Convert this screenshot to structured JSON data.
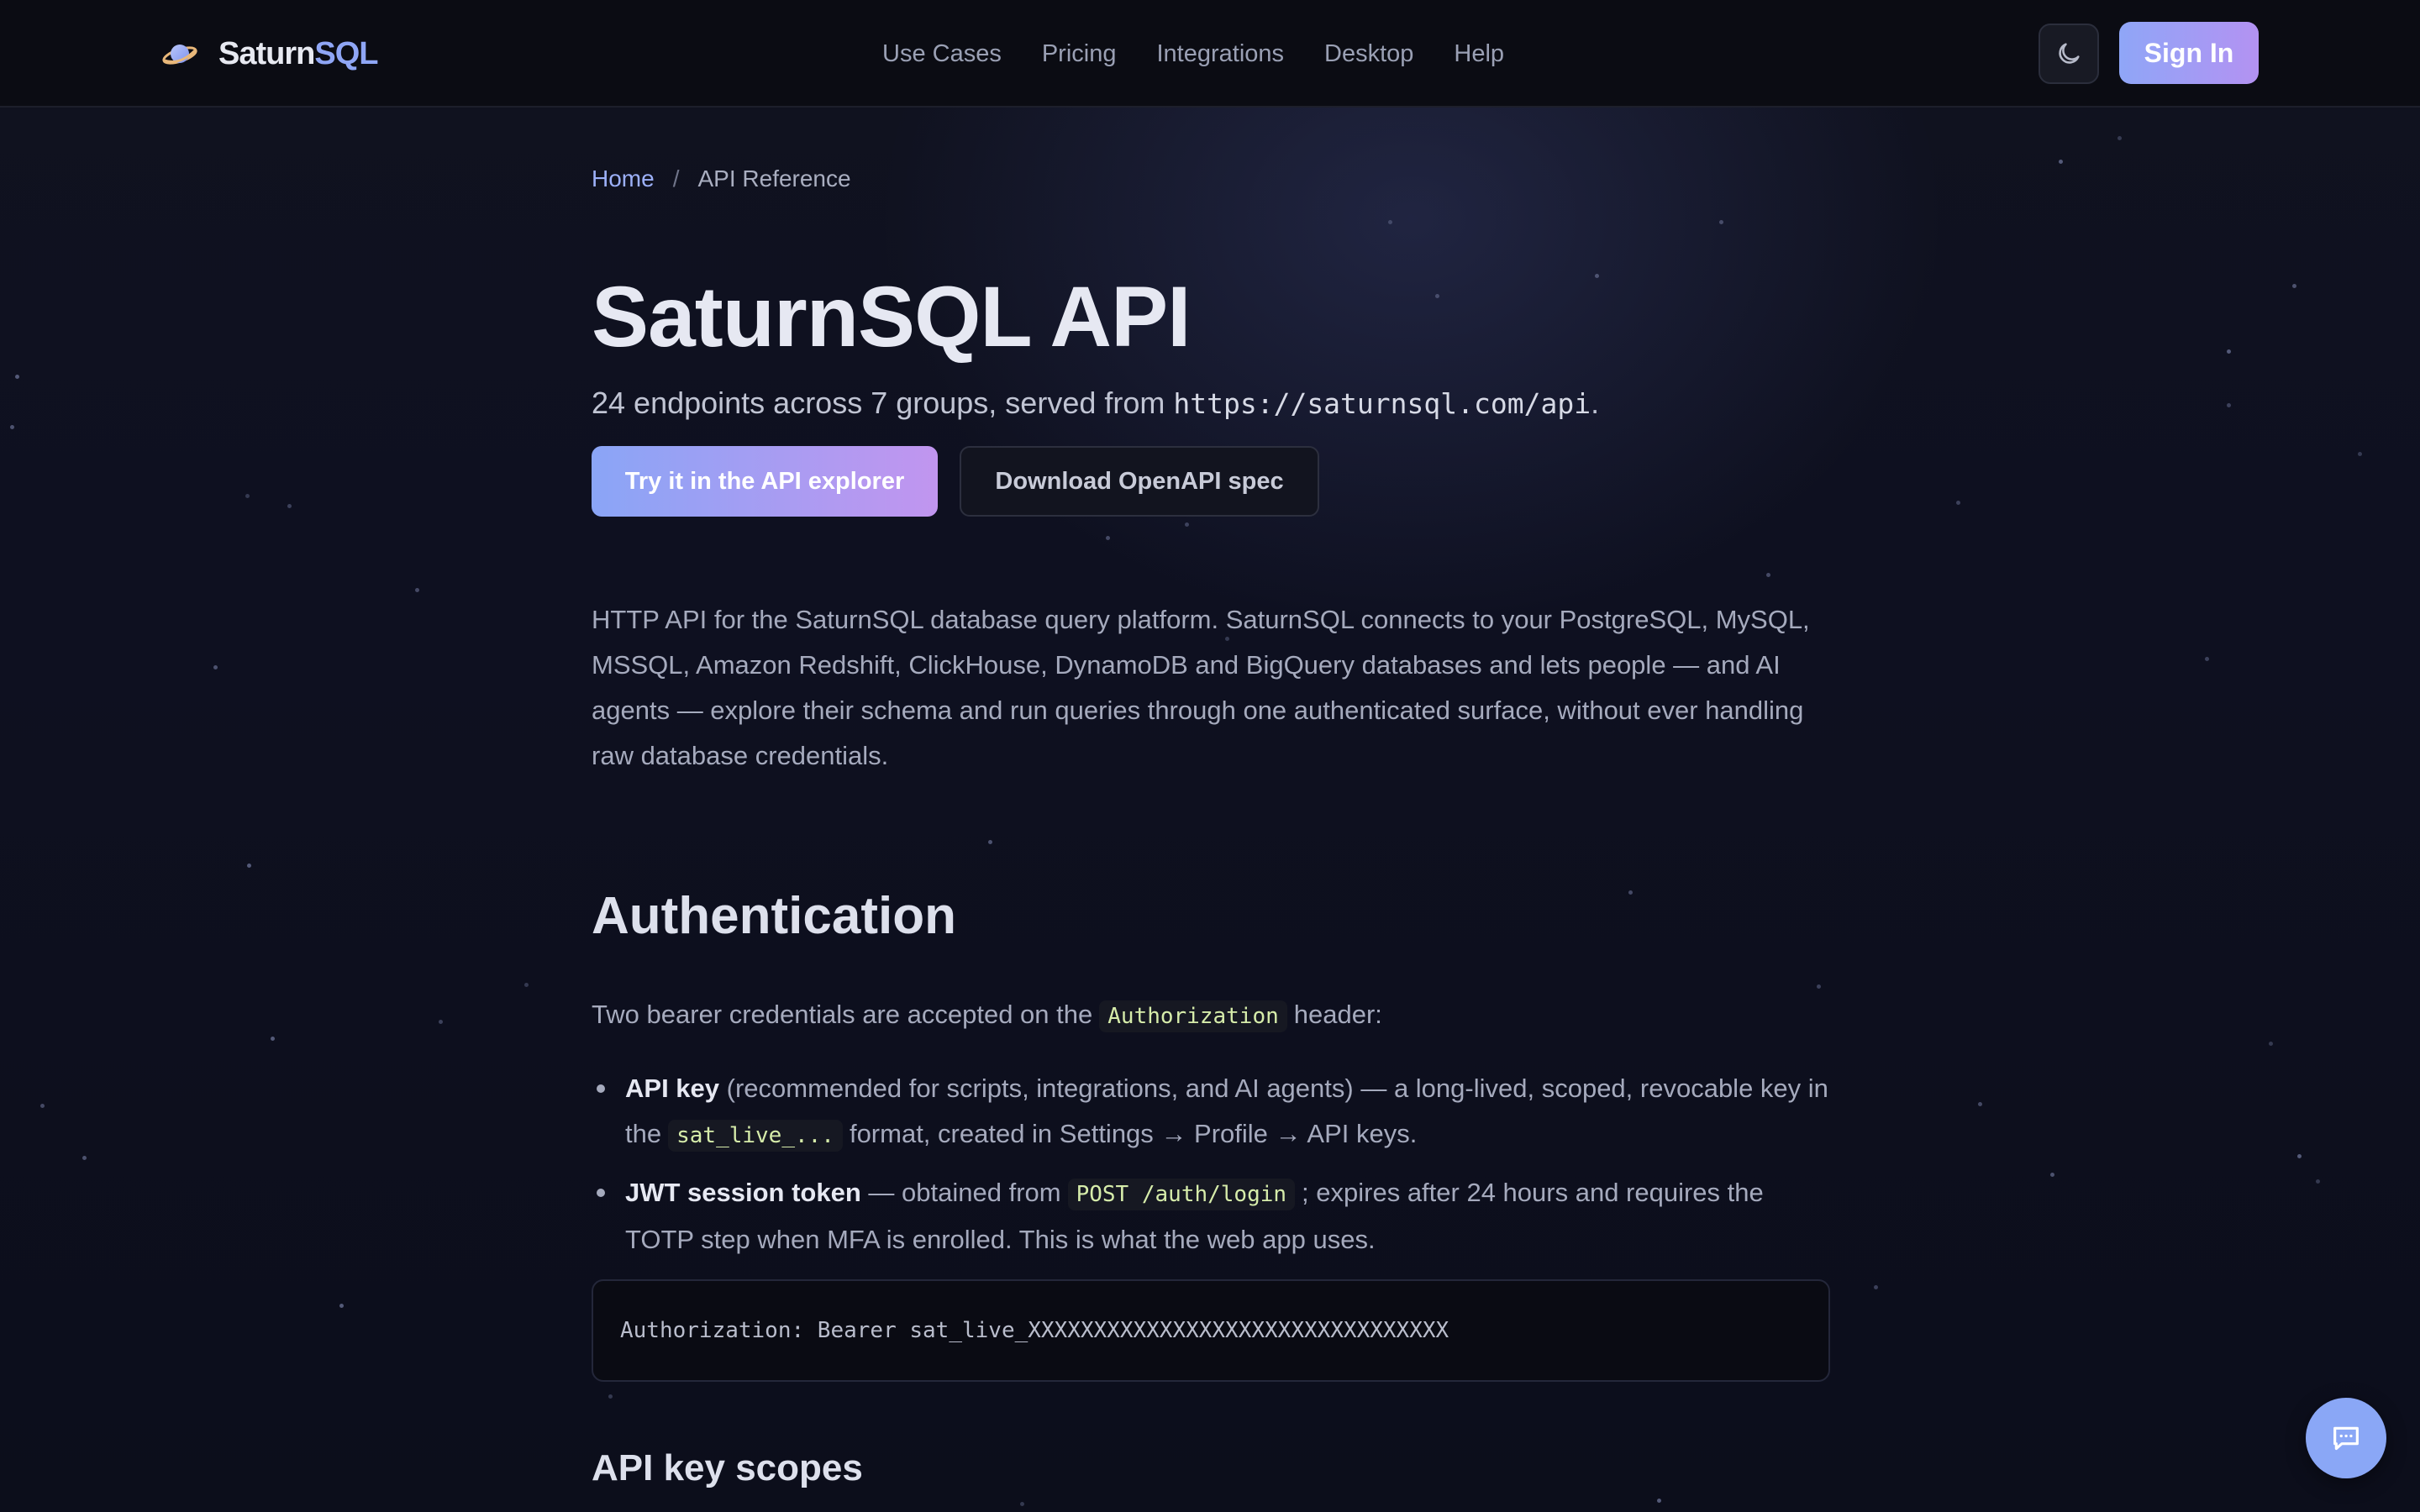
{
  "brand": {
    "name_prefix": "Saturn",
    "name_accent": "SQL"
  },
  "nav": {
    "items": [
      {
        "label": "Use Cases"
      },
      {
        "label": "Pricing"
      },
      {
        "label": "Integrations"
      },
      {
        "label": "Desktop"
      },
      {
        "label": "Help"
      }
    ]
  },
  "header": {
    "theme_icon": "moon-icon",
    "sign_in_label": "Sign In"
  },
  "breadcrumb": {
    "home": "Home",
    "separator": "/",
    "current": "API Reference"
  },
  "hero": {
    "title": "SaturnSQL API",
    "subtitle_prefix": "24 endpoints across 7 groups, served from ",
    "subtitle_url": "https://saturnsql.com/api",
    "subtitle_suffix": ".",
    "primary_cta": "Try it in the API explorer",
    "secondary_cta": "Download OpenAPI spec"
  },
  "intro": {
    "text": "HTTP API for the SaturnSQL database query platform. SaturnSQL connects to your PostgreSQL, MySQL, MSSQL, Amazon Redshift, ClickHouse, DynamoDB and BigQuery databases and lets people — and AI agents — explore their schema and run queries through one authenticated surface, without ever handling raw database credentials."
  },
  "authentication": {
    "title": "Authentication",
    "intro_prefix": "Two bearer credentials are accepted on the",
    "intro_code": "Authorization",
    "intro_suffix": "header:",
    "items": [
      {
        "term": "API key",
        "text_a": " (recommended for scripts, integrations, and AI agents) — a long-lived, scoped, revocable key in the",
        "code": "sat_live_...",
        "text_b": "format, created in Settings → Profile → API keys."
      },
      {
        "term": "JWT session token",
        "text_a": " — obtained from",
        "code": "POST /auth/login",
        "text_b": "; expires after 24 hours and requires the TOTP step when MFA is enrolled. This is what the web app uses."
      }
    ],
    "code_example": "Authorization: Bearer sat_live_XXXXXXXXXXXXXXXXXXXXXXXXXXXXXXXX"
  },
  "scopes": {
    "title": "API key scopes"
  },
  "chat": {
    "icon": "chat-bubble-icon"
  },
  "colors": {
    "background": "#0d0f1c",
    "accent_start": "#8aa5f6",
    "accent_end": "#c195ef",
    "link": "#9cb0f8",
    "inline_code": "#d6ecaa"
  }
}
